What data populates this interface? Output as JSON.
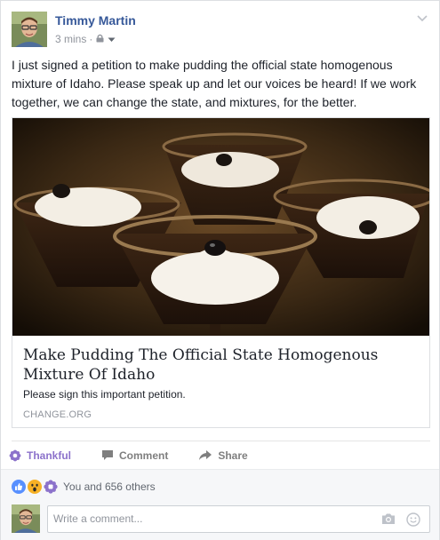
{
  "post": {
    "author": "Timmy Martin",
    "time": "3 mins",
    "separator": "·",
    "privacy_icon": "lock-icon",
    "text": "I just signed a petition to make pudding the official state homogenous mixture of Idaho. Please speak up and let our voices be heard! If we work together, we can change the state, and mixtures, for the better."
  },
  "link": {
    "title": "Make Pudding The Official State Homogenous Mixture Of Idaho",
    "description": "Please sign this important petition.",
    "domain": "CHANGE.ORG"
  },
  "actions": {
    "thankful": "Thankful",
    "comment": "Comment",
    "share": "Share"
  },
  "reactions": {
    "icons": [
      "like-icon",
      "wow-icon",
      "thankful-icon"
    ],
    "summary": "You and 656 others"
  },
  "comment_box": {
    "placeholder": "Write a comment..."
  },
  "colors": {
    "author_link": "#365899",
    "thankful": "#8c72cb",
    "like": "#5890ff",
    "wow": "#f7b125",
    "muted": "#90949c",
    "footer_bg": "#f6f7f9"
  }
}
